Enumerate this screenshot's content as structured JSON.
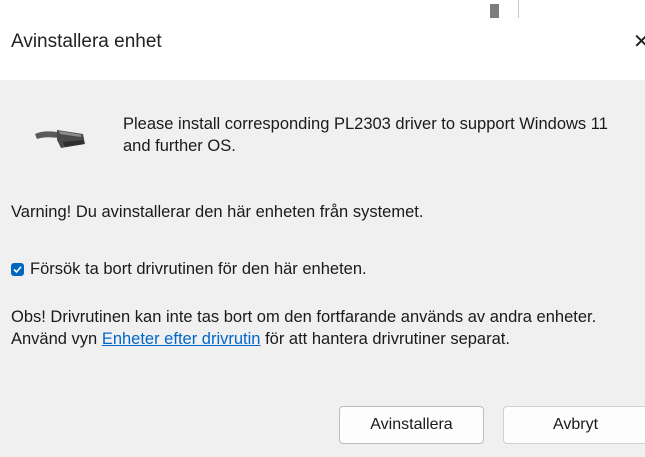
{
  "dialog": {
    "title": "Avinstallera enhet",
    "close_glyph": "✕"
  },
  "device": {
    "icon": "serial-cable-icon",
    "message": "Please install corresponding PL2303 driver to support Windows 11 and further OS."
  },
  "warning_text": "Varning! Du avinstallerar den här enheten från systemet.",
  "checkbox": {
    "label": "Försök ta bort drivrutinen för den här enheten.",
    "checked": true
  },
  "note": {
    "prefix": "Obs! Drivrutinen kan inte tas bort om den fortfarande används av andra enheter. Använd vyn ",
    "link": "Enheter efter drivrutin",
    "suffix": " för att hantera drivrutiner separat."
  },
  "buttons": {
    "uninstall": "Avinstallera",
    "cancel": "Avbryt"
  },
  "colors": {
    "accent": "#0067c0",
    "link": "#0066cc",
    "background": "#f0f0f0"
  }
}
